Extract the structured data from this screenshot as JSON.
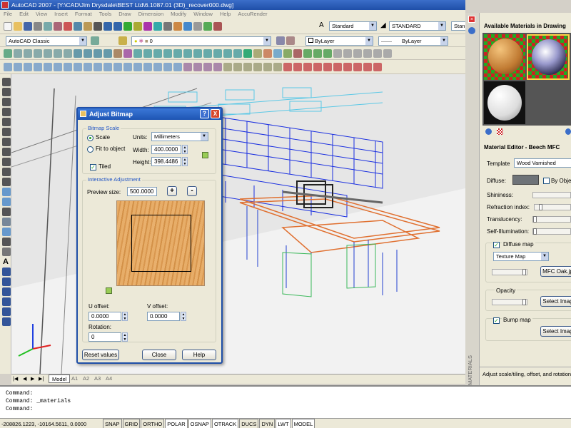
{
  "window": {
    "title": "AutoCAD 2007 - [Y:\\CAD\\Jim Drysdale\\BEST Ltd\\6.1087.01 (3D)_recover000.dwg]"
  },
  "menu": [
    "File",
    "Edit",
    "View",
    "Insert",
    "Format",
    "Tools",
    "Draw",
    "Dimension",
    "Modify",
    "Window",
    "Help",
    "AccuRender"
  ],
  "toolbar": {
    "text_style": "Standard",
    "dim_style": "STANDARD",
    "table_style": "Stan",
    "workspace": "AutoCAD Classic",
    "layer": "0",
    "color": "ByLayer",
    "linetype": "ByLayer"
  },
  "dialog": {
    "title": "Adjust Bitmap",
    "help": "?",
    "close": "X",
    "bitmap_scale": {
      "label": "Bitmap Scale",
      "scale": "Scale",
      "fit": "Fit to object",
      "units_label": "Units:",
      "units": "Millimeters",
      "width_label": "Width:",
      "width": "400.0000",
      "height_label": "Height:",
      "height": "398.4486",
      "tiled": "Tiled"
    },
    "interactive": {
      "label": "Interactive Adjustment",
      "preview_label": "Preview size:",
      "preview": "500.0000",
      "plus": "+",
      "minus": "-",
      "u_label": "U offset:",
      "u": "0.0000",
      "v_label": "V offset:",
      "v": "0.0000",
      "rot_label": "Rotation:",
      "rot": "0"
    },
    "buttons": {
      "reset": "Reset values",
      "close": "Close",
      "help": "Help"
    }
  },
  "materials_panel": {
    "available_title": "Available Materials in Drawing",
    "editor_title": "Material Editor - Beech MFC",
    "template_label": "Template",
    "template": "Wood Varnished",
    "diffuse_label": "Diffuse:",
    "by_object": "By Obje",
    "shininess": "Shininess:",
    "refraction": "Refraction index:",
    "translucency": "Translucency:",
    "self_illum": "Self-Illumination:",
    "diffuse_map": "Diffuse map",
    "map_type": "Texture Map",
    "map_file": "MFC Oak.jp",
    "opacity": "Opacity",
    "select_image": "Select Imag",
    "bump_map": "Bump map",
    "select_image2": "Select Imag",
    "hint": "Adjust scale/tiling, offset, and rotation",
    "side_label": "MATERIALS"
  },
  "tabs": {
    "model": "Model",
    "l1": "A1",
    "l2": "A2",
    "l3": "A3",
    "l4": "A4"
  },
  "command": {
    "line1": "Command:",
    "line2": "Command: _materials",
    "line3": "Command:"
  },
  "status": {
    "coords": "-208826.1223, -10164.5611, 0.0000",
    "toggles": [
      "SNAP",
      "GRID",
      "ORTHO",
      "POLAR",
      "OSNAP",
      "OTRACK",
      "DUCS",
      "DYN",
      "LWT",
      "MODEL"
    ]
  },
  "colors": {
    "titlebar": "#1f4fa8",
    "wood": "#e0a35a",
    "wireframe_blue": "#1a2fe0"
  }
}
